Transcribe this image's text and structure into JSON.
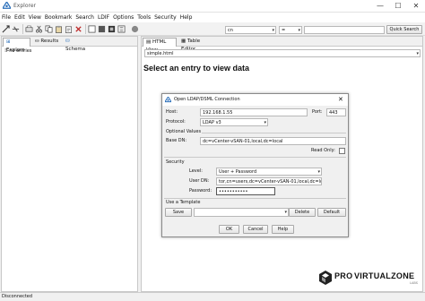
{
  "window": {
    "title": "Explorer",
    "minimize": "—",
    "maximize": "☐",
    "close": "✕"
  },
  "menu": [
    "File",
    "Edit",
    "View",
    "Bookmark",
    "Search",
    "LDIF",
    "Options",
    "Tools",
    "Security",
    "Help"
  ],
  "toolbar": {
    "search_base": "cn",
    "operator": "=",
    "search_value": "",
    "quick_search_label": "Quick Search"
  },
  "left": {
    "tabs": [
      "Explore",
      "Results",
      "Schema"
    ],
    "tree_item": "no entries"
  },
  "right": {
    "tabs": [
      "HTML View",
      "Table Editor"
    ],
    "template_select": "simple.html",
    "heading": "Select an entry to view data"
  },
  "dialog": {
    "title": "Open LDAP/DSML Connection",
    "host_label": "Host:",
    "host_value": "192.168.1.55",
    "port_label": "Port:",
    "port_value": "443",
    "protocol_label": "Protocol:",
    "protocol_value": "LDAP v3",
    "optional_label": "Optional Values",
    "basedn_label": "Base DN:",
    "basedn_value": "dc=vCenter-vSAN-01,local,dc=local",
    "readonly_label": "Read Only:",
    "security_label": "Security",
    "level_label": "Level:",
    "level_value": "User + Password",
    "userdn_label": "User DN:",
    "userdn_value": "tor,cn=users,dc=vCenter-vSAN-01,local,dc=local",
    "password_label": "Password:",
    "password_value": "•••••••••••",
    "template_label": "Use a Template",
    "save_label": "Save",
    "template_value": "",
    "delete_label": "Delete",
    "default_label": "Default",
    "ok_label": "OK",
    "cancel_label": "Cancel",
    "help_label": "Help"
  },
  "watermark": {
    "pro": "PRO",
    "virtualzone": "VIRTUALZONE",
    "sub": "LABS"
  },
  "status": "Disconnected",
  "colors": {
    "accent": "#1f6fc5",
    "title_text": "#555555"
  }
}
